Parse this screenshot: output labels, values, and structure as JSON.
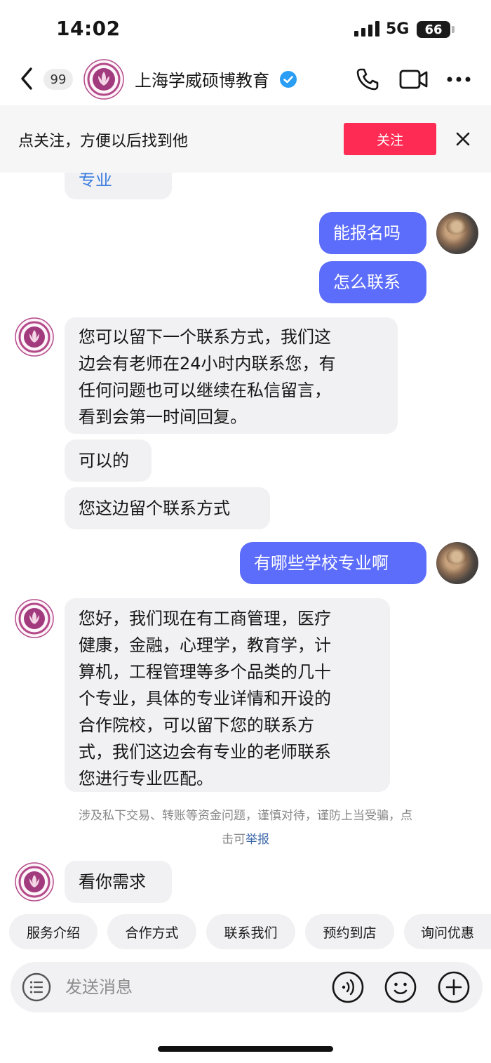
{
  "status_bar": {
    "time": "14:02",
    "network": "5G",
    "battery": "66"
  },
  "header": {
    "unread_count": "99",
    "title": "上海学威硕博教育"
  },
  "follow_bar": {
    "text": "点关注，方便以后找到他",
    "button_label": "关注"
  },
  "messages": [
    {
      "side": "in",
      "lines": [
        "专业"
      ]
    },
    {
      "side": "out",
      "lines": [
        "能报名吗"
      ]
    },
    {
      "side": "out",
      "lines": [
        "怎么联系"
      ]
    },
    {
      "side": "in",
      "lines": [
        "您可以留下一个联系方式，我们这",
        "边会有老师在24小时内联系您，有",
        "任何问题也可以继续在私信留言，",
        "看到会第一时间回复。"
      ]
    },
    {
      "side": "in",
      "lines": [
        "可以的"
      ]
    },
    {
      "side": "in",
      "lines": [
        "您这边留个联系方式"
      ]
    },
    {
      "side": "out",
      "lines": [
        "有哪些学校专业啊"
      ]
    },
    {
      "side": "in",
      "lines": [
        "您好，我们现在有工商管理，医疗",
        "健康，金融，心理学，教育学，计",
        "算机，工程管理等多个品类的几十",
        "个专业，具体的专业详情和开设的",
        "合作院校，可以留下您的联系方",
        "式，我们这边会有专业的老师联系",
        "您进行专业匹配。"
      ]
    },
    {
      "side": "in",
      "lines": [
        "看你需求"
      ]
    }
  ],
  "warning": {
    "line1": "涉及私下交易、转账等资金问题，谨慎对待，谨防上当受骗，点",
    "line2_prefix": "击可",
    "report_link": "举报"
  },
  "quick_replies": [
    "服务介绍",
    "合作方式",
    "联系我们",
    "预约到店",
    "询问优惠"
  ],
  "input": {
    "placeholder": "发送消息"
  },
  "colors": {
    "accent": "#fe2c55",
    "outgoing_bubble": "#5c6cfb",
    "incoming_bubble": "#f1f1f3",
    "verified": "#2a9df4",
    "org_avatar": "#a23b7e"
  }
}
